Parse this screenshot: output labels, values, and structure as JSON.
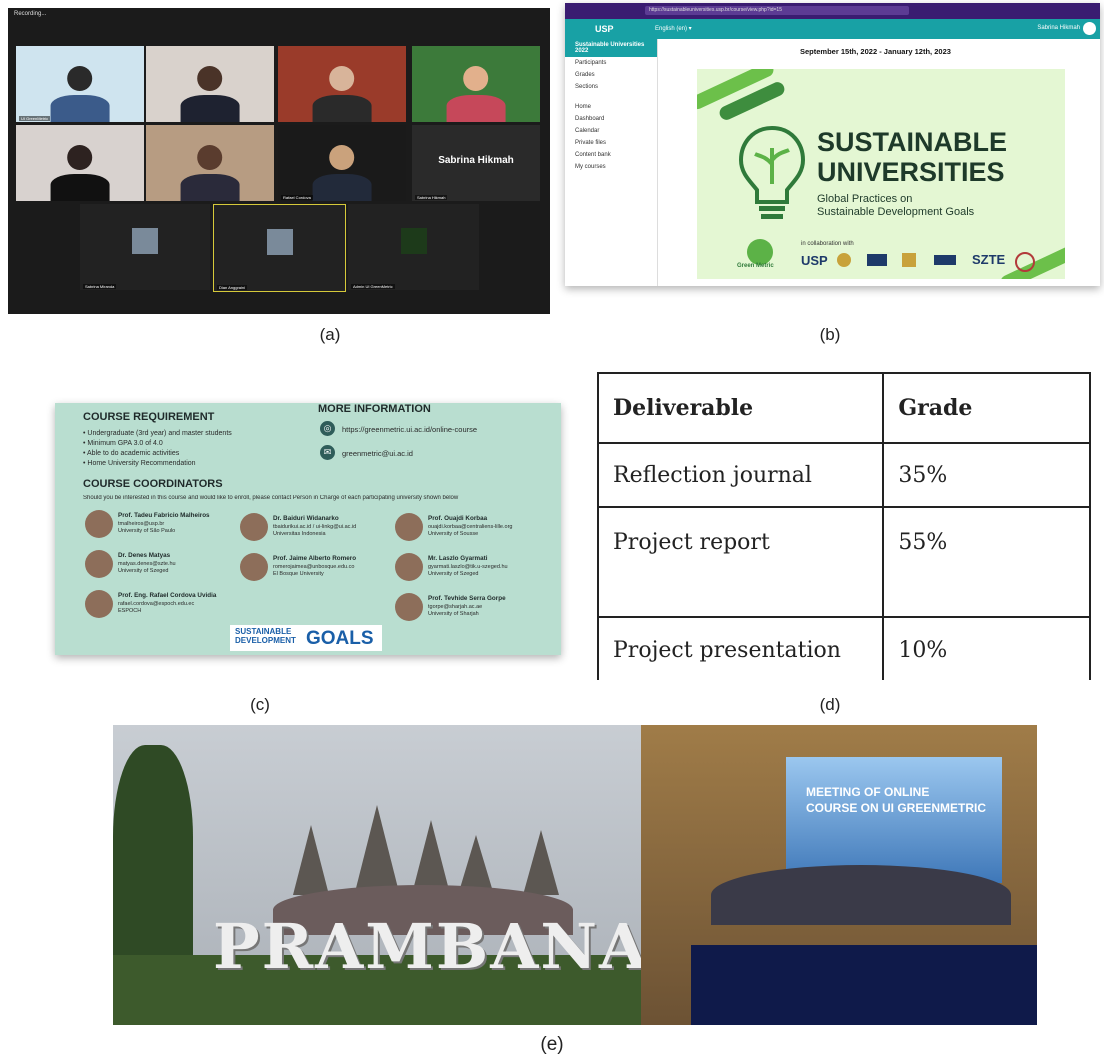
{
  "captions": {
    "a": "(a)",
    "b": "(b)",
    "c": "(c)",
    "d": "(d)",
    "e": "(e)"
  },
  "zoom": {
    "recording": "Recording...",
    "participants": [
      "UI GreenMetric",
      "",
      "",
      "",
      "",
      "",
      "Rafael Cordova",
      "Sabrina Hikmah",
      "Sabrina Miranda",
      "Dian Anggraini",
      "Admin UI GreenMetric"
    ],
    "big_name": "Sabrina Hikmah",
    "colors": {
      "background": "#1b1b1b",
      "active_border": "#d6c93a"
    }
  },
  "lms": {
    "url": "https://sustainableuniversities.usp.br/course/view.php?id=15",
    "logo": "USP",
    "lang": "English (en) ▾",
    "user": "Sabrina Hikmah",
    "sidebar": {
      "course": "Sustainable Universities 2022",
      "items": [
        "Participants",
        "Grades",
        "Sections"
      ],
      "nav": [
        "Home",
        "Dashboard",
        "Calendar",
        "Private files",
        "Content bank",
        "My courses"
      ]
    },
    "date": "September 15th, 2022 - January 12th, 2023",
    "banner": {
      "title1": "SUSTAINABLE",
      "title2": "UNIVERSITIES",
      "sub1": "Global Practices on",
      "sub2": "Sustainable Development Goals",
      "collab": "in collaboration with",
      "partners": [
        "Green Metric",
        "USP",
        "SZTE"
      ]
    },
    "colors": {
      "accent": "#18a1a5",
      "banner": "#e4f7d3"
    }
  },
  "flyer": {
    "req_title": "COURSE REQUIREMENT",
    "requirements": [
      "Undergraduate (3rd year) and master students",
      "Minimum GPA 3.0 of 4.0",
      "Able to do academic activities",
      "Home University Recommendation"
    ],
    "more_title": "MORE INFORMATION",
    "url": "https://greenmetric.ui.ac.id/online-course",
    "email": "greenmetric@ui.ac.id",
    "coord_title": "COURSE COORDINATORS",
    "coord_note": "Should you be interested in this course and would like to enroll, please contact Person in Charge of each participating university shown below",
    "coordinators": [
      {
        "name": "Prof. Tadeu Fabricio Malheiros",
        "email": "tmalheiros@usp.br",
        "org": "University of São Paulo"
      },
      {
        "name": "Dr. Denes Matyas",
        "email": "matyas.denes@szte.hu",
        "org": "University of Szeged"
      },
      {
        "name": "Prof. Eng. Rafael Cordova Uvidia",
        "email": "rafael.cordova@espoch.edu.ec",
        "org": "ESPOCH"
      },
      {
        "name": "Dr. Baiduri Widanarko",
        "email": "tbaidurikui.ac.id / ui-linkg@ui.ac.id",
        "org": "Universitas Indonesia"
      },
      {
        "name": "Prof. Jaime Alberto Romero",
        "email": "romerojaimea@unbosque.edu.co",
        "org": "El Bosque University"
      },
      {
        "name": "Prof. Ouajdi Korbaa",
        "email": "ouajdi.korbaa@centraliens-lille.org",
        "org": "University of Sousse"
      },
      {
        "name": "Mr. Laszlo Gyarmati",
        "email": "gyarmati.laszlo@tik.u-szeged.hu",
        "org": "University of Szeged"
      },
      {
        "name": "Prof. Tevhide Serra Gorpe",
        "email": "tgorpe@sharjah.ac.ae",
        "org": "University of Sharjah"
      }
    ],
    "sdg1": "SUSTAINABLE",
    "sdg2": "DEVELOPMENT",
    "sdg3": "GOALS",
    "colors": {
      "background": "#b9ded0",
      "sdg_blue": "#1a5fa8"
    }
  },
  "grades": {
    "headers": [
      "Deliverable",
      "Grade"
    ],
    "rows": [
      [
        "Reflection journal",
        "35%"
      ],
      [
        "Project report",
        "55%"
      ],
      [
        "Project presentation",
        "10%"
      ]
    ]
  },
  "photos": {
    "sign": "PRAMBANAN",
    "screen1": "MEETING OF ONLINE",
    "screen2": "COURSE ON UI GREENMETRIC"
  }
}
